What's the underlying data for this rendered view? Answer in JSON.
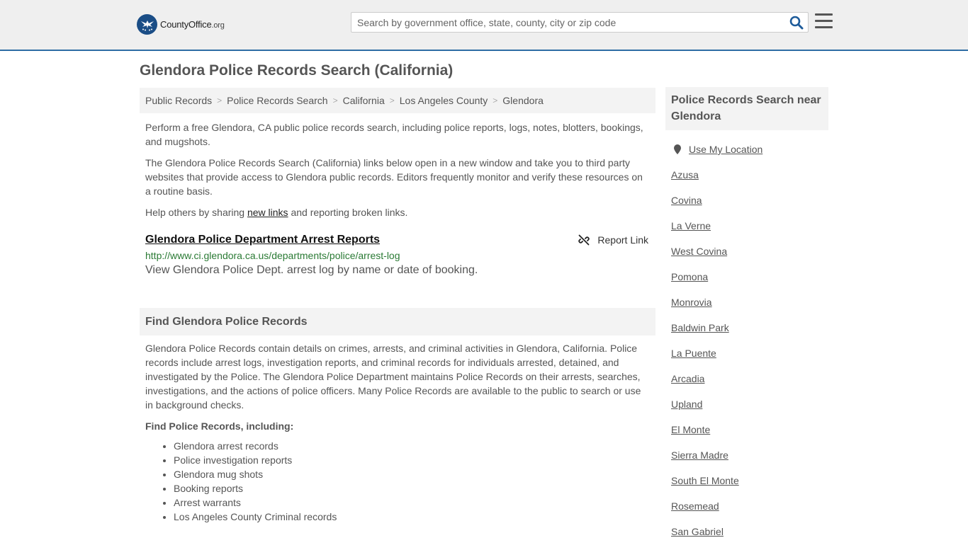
{
  "header": {
    "logo_main": "CountyOffice",
    "logo_suffix": ".org",
    "search_placeholder": "Search by government office, state, county, city or zip code"
  },
  "page": {
    "title": "Glendora Police Records Search (California)"
  },
  "breadcrumb": [
    "Public Records",
    "Police Records Search",
    "California",
    "Los Angeles County",
    "Glendora"
  ],
  "intro": {
    "p1": "Perform a free Glendora, CA public police records search, including police reports, logs, notes, blotters, bookings, and mugshots.",
    "p2": "The Glendora Police Records Search (California) links below open in a new window and take you to third party websites that provide access to Glendora public records. Editors frequently monitor and verify these resources on a routine basis.",
    "p3_before": "Help others by sharing ",
    "p3_link": "new links",
    "p3_after": " and reporting broken links."
  },
  "result": {
    "title": "Glendora Police Department Arrest Reports",
    "report_label": "Report Link",
    "url": "http://www.ci.glendora.ca.us/departments/police/arrest-log",
    "description": "View Glendora Police Dept. arrest log by name or date of booking."
  },
  "find_section": {
    "heading": "Find Glendora Police Records",
    "body": "Glendora Police Records contain details on crimes, arrests, and criminal activities in Glendora, California. Police records include arrest logs, investigation reports, and criminal records for individuals arrested, detained, and investigated by the Police. The Glendora Police Department maintains Police Records on their arrests, searches, investigations, and the actions of police officers. Many Police Records are available to the public to search or use in background checks.",
    "subheading": "Find Police Records, including:",
    "items": [
      "Glendora arrest records",
      "Police investigation reports",
      "Glendora mug shots",
      "Booking reports",
      "Arrest warrants",
      "Los Angeles County Criminal records"
    ]
  },
  "sidebar": {
    "heading": "Police Records Search near Glendora",
    "use_location": "Use My Location",
    "cities": [
      "Azusa",
      "Covina",
      "La Verne",
      "West Covina",
      "Pomona",
      "Monrovia",
      "Baldwin Park",
      "La Puente",
      "Arcadia",
      "Upland",
      "El Monte",
      "Sierra Madre",
      "South El Monte",
      "Rosemead",
      "San Gabriel"
    ]
  }
}
